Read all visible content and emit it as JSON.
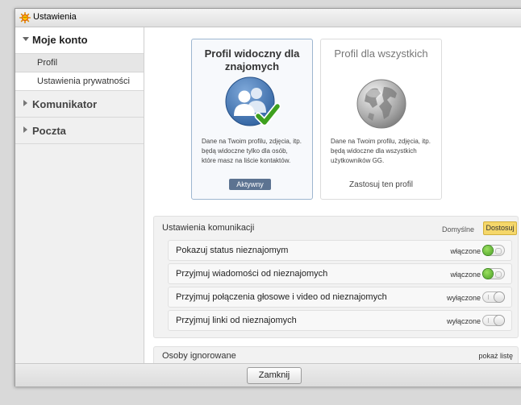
{
  "window": {
    "title": "Ustawienia"
  },
  "sidebar": {
    "account": {
      "label": "Moje konto",
      "items": [
        {
          "label": "Profil"
        },
        {
          "label": "Ustawienia prywatności"
        }
      ]
    },
    "sections": [
      {
        "label": "Komunikator"
      },
      {
        "label": "Poczta"
      }
    ]
  },
  "profile_cards": [
    {
      "title": "Profil widoczny dla znajomych",
      "icon": "contacts-check-icon",
      "description": "Dane na Twoim profilu, zdjęcia, itp. będą widoczne tylko dla osób, które masz na liście kontaktów.",
      "badge": "Aktywny"
    },
    {
      "title": "Profil dla wszystkich",
      "icon": "globe-icon",
      "description": "Dane na Twoim profilu, zdjęcia, itp. będą widoczne dla wszystkich użytkowników GG.",
      "action": "Zastosuj ten profil"
    }
  ],
  "communication": {
    "title": "Ustawienia komunikacji",
    "default_label": "Domyślne",
    "custom_label": "Dostosuj",
    "rows": [
      {
        "label": "Pokazuj status nieznajomym",
        "state": "włączone",
        "on": true
      },
      {
        "label": "Przyjmuj wiadomości od nieznajomych",
        "state": "włączone",
        "on": true
      },
      {
        "label": "Przyjmuj połączenia głosowe i video od nieznajomych",
        "state": "wyłączone",
        "on": false
      },
      {
        "label": "Przyjmuj linki od nieznajomych",
        "state": "wyłączone",
        "on": false
      }
    ]
  },
  "ignored": {
    "label": "Osoby ignorowane",
    "link": "pokaż listę"
  },
  "footer": {
    "close_label": "Zamknij"
  },
  "colors": {
    "accent_blue": "#5c7391",
    "highlight_yellow": "#f5d76a",
    "toggle_green": "#4aa023"
  }
}
